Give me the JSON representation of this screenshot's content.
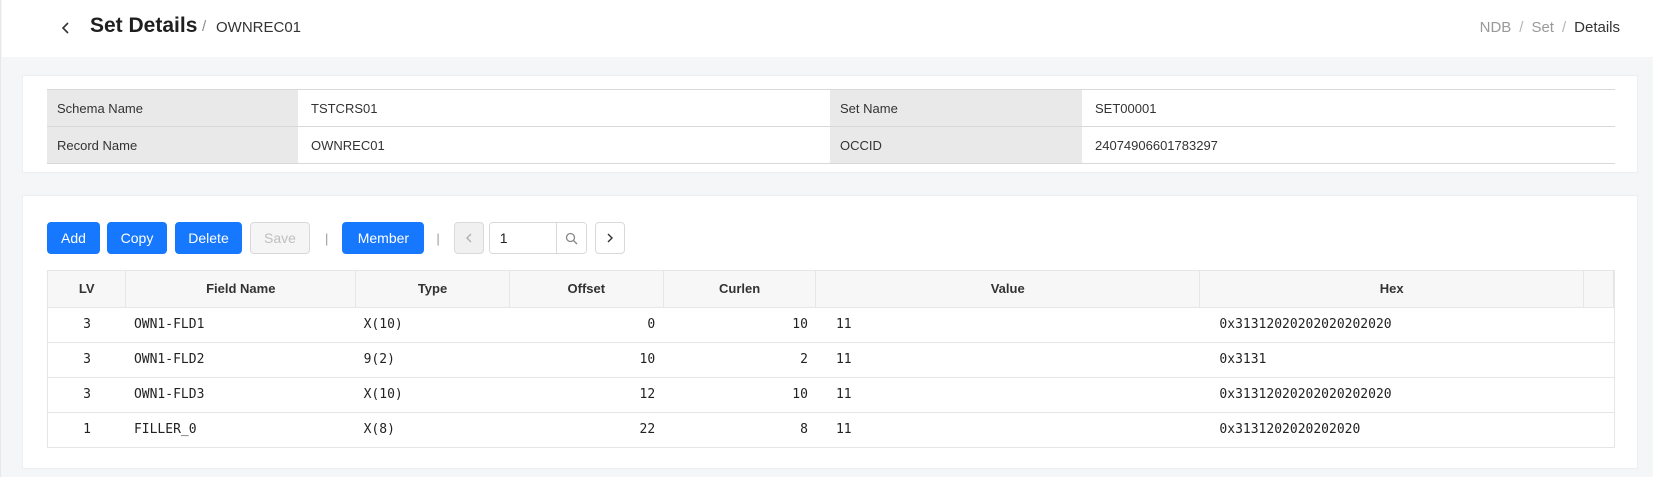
{
  "header": {
    "title": "Set Details",
    "separator": "/",
    "subtitle": "OWNREC01",
    "breadcrumb": [
      "NDB",
      "Set",
      "Details"
    ],
    "breadcrumb_sep": "/"
  },
  "info": {
    "schema_name_label": "Schema Name",
    "schema_name_value": "TSTCRS01",
    "set_name_label": "Set Name",
    "set_name_value": "SET00001",
    "record_name_label": "Record Name",
    "record_name_value": "OWNREC01",
    "occid_label": "OCCID",
    "occid_value": "24074906601783297"
  },
  "toolbar": {
    "add_label": "Add",
    "copy_label": "Copy",
    "delete_label": "Delete",
    "save_label": "Save",
    "save_disabled": true,
    "separator": "|",
    "member_label": "Member",
    "page_value": "1",
    "accent_color": "#1677ff"
  },
  "grid": {
    "columns": [
      "LV",
      "Field Name",
      "Type",
      "Offset",
      "Curlen",
      "Value",
      "Hex"
    ],
    "rows": [
      {
        "lv": "3",
        "field": "OWN1-FLD1",
        "type": "X(10)",
        "offset": "0",
        "curlen": "10",
        "value": "11",
        "hex": "0x31312020202020202020"
      },
      {
        "lv": "3",
        "field": "OWN1-FLD2",
        "type": "9(2)",
        "offset": "10",
        "curlen": "2",
        "value": "11",
        "hex": "0x3131"
      },
      {
        "lv": "3",
        "field": "OWN1-FLD3",
        "type": "X(10)",
        "offset": "12",
        "curlen": "10",
        "value": "11",
        "hex": "0x31312020202020202020"
      },
      {
        "lv": "1",
        "field": "FILLER_0",
        "type": "X(8)",
        "offset": "22",
        "curlen": "8",
        "value": "11",
        "hex": "0x3131202020202020"
      }
    ]
  },
  "icons": {
    "back": "chevron-left-icon",
    "prev": "chevron-left-icon",
    "next": "chevron-right-icon",
    "search": "search-icon"
  }
}
